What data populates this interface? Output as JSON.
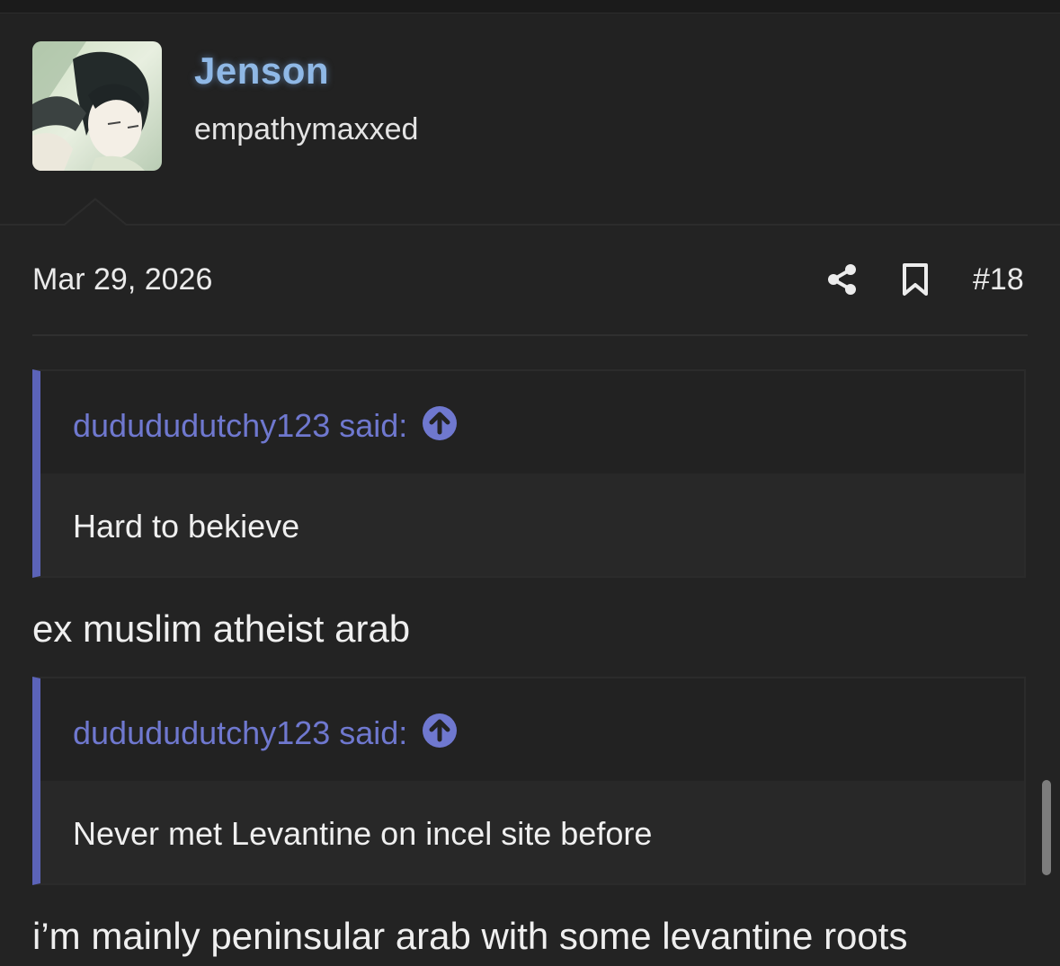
{
  "user": {
    "name": "Jenson",
    "title": "empathymaxxed"
  },
  "post": {
    "date": "Mar 29, 2026",
    "number": "#18"
  },
  "content": {
    "quotes": [
      {
        "author": "dudududutchy123 said:",
        "text": "Hard to bekieve"
      },
      {
        "author": "dudududutchy123 said:",
        "text": "Never met Levantine on incel site before"
      }
    ],
    "replies": [
      "ex muslim atheist arab",
      "i’m mainly peninsular arab with some levantine roots"
    ]
  },
  "icons": {
    "share": "share-icon",
    "bookmark": "bookmark-icon",
    "quote_jump": "arrow-up-circle-icon"
  },
  "colors": {
    "username": "#8fb8e6",
    "quote_accent": "#5b63b8",
    "quote_author": "#6f78cf",
    "background": "#232323"
  }
}
